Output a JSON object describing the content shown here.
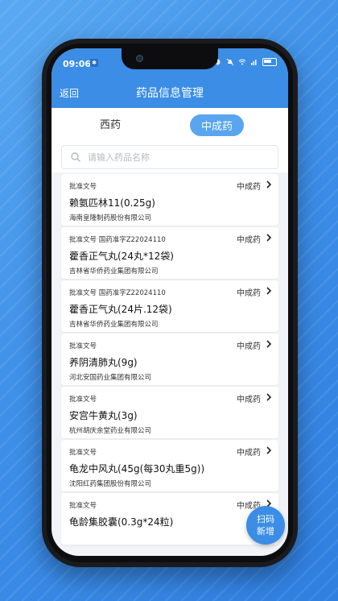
{
  "status_bar": {
    "time": "09:06",
    "badge": "✱"
  },
  "app_bar": {
    "back_label": "返回",
    "title": "药品信息管理"
  },
  "tabs": [
    {
      "label": "西药",
      "active": false
    },
    {
      "label": "中成药",
      "active": true
    }
  ],
  "search": {
    "placeholder": "请输入药品名称",
    "value": ""
  },
  "items": [
    {
      "approval": "批准文号",
      "type": "中成药",
      "name": "赖氨匹林11(0.25g)",
      "company": "海南皇隆制药股份有限公司"
    },
    {
      "approval": "批准文号 国药准字Z22024110",
      "type": "中成药",
      "name": "藿香正气丸(24丸*12袋)",
      "company": "吉林省华侨药业集团有限公司"
    },
    {
      "approval": "批准文号 国药准字Z22024110",
      "type": "中成药",
      "name": "藿香正气丸(24片.12袋)",
      "company": "吉林省华侨药业集团有限公司"
    },
    {
      "approval": "批准文号",
      "type": "中成药",
      "name": "养阴清肺丸(9g)",
      "company": "河北安国药业集团有限公司"
    },
    {
      "approval": "批准文号",
      "type": "中成药",
      "name": "安宫牛黄丸(3g)",
      "company": "杭州胡庆余堂药业有限公司"
    },
    {
      "approval": "批准文号",
      "type": "中成药",
      "name": "龟龙中风丸(45g(每30丸重5g))",
      "company": "沈阳红药集团股份有限公司"
    },
    {
      "approval": "批准文号",
      "type": "中成药",
      "name": "龟龄集胶囊(0.3g*24粒)",
      "company": ""
    }
  ],
  "fab": {
    "label_line1": "扫码",
    "label_line2": "新增"
  },
  "colors": {
    "primary": "#3b8de6",
    "tab_active": "#5aa5ef",
    "background": "#f2f3f6"
  }
}
